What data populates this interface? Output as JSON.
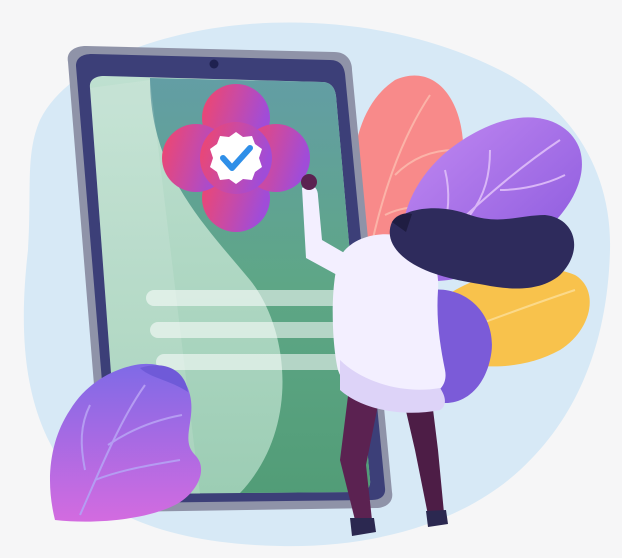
{
  "illustration": {
    "subject": "verified-badge-on-tablet",
    "icons": [
      "tablet-icon",
      "verified-check-icon",
      "flower-badge-icon"
    ],
    "colors": {
      "background": "#f6f6f7",
      "blob": "#d7e9f6",
      "tablet_frame": "#8f93a8",
      "tablet_bezel": "#3c3f78",
      "screen_green": "#5aa483",
      "screen_light": "#a9d3be",
      "badge_pink": "#f2466a",
      "badge_purple": "#a04cd8",
      "check_blue": "#2f8fe8",
      "leaf_coral": "#f88a8a",
      "leaf_violet": "#9966e3",
      "leaf_yellow": "#f8c24c",
      "hair": "#2e2b5c",
      "pants": "#5b2251"
    }
  }
}
